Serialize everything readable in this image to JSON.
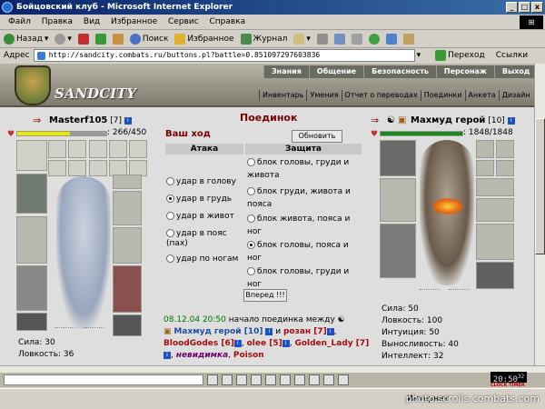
{
  "window": {
    "title": "Бойцовский клуб - Microsoft Internet Explorer",
    "min": "_",
    "max": "□",
    "close": "x"
  },
  "menu": [
    "Файл",
    "Правка",
    "Вид",
    "Избранное",
    "Сервис",
    "Справка"
  ],
  "toolbar": {
    "back": "Назад",
    "search": "Поиск",
    "favorites": "Избранное",
    "journal": "Журнал"
  },
  "address": {
    "label": "Адрес",
    "url": "http://sandcity.combats.ru/buttons.pl?battle=0.851097297603836",
    "go": "Переход",
    "links": "Ссылки"
  },
  "site": {
    "brand": "SANDCITY",
    "topnav": [
      "Знания",
      "Общение",
      "Безопасность",
      "Персонаж",
      "Выход"
    ],
    "subnav": [
      "Инвентарь",
      "Умения",
      "Отчет о переводах",
      "Поединки",
      "Анкета",
      "Дизайн"
    ]
  },
  "player": {
    "name": "Masterf105",
    "level": "[7]",
    "hp": ": 266/450",
    "hp_fraction": 0.59,
    "stats": [
      "Сила: 30",
      "Ловкость: 36"
    ]
  },
  "enemy": {
    "name": "Махмуд герой",
    "level": "[10]",
    "hp": ": 1848/1848",
    "hp_fraction": 1.0,
    "stats": [
      "Сила: 50",
      "Ловкость: 100",
      "Интуиция: 50",
      "Выносливость: 40",
      "Интеллект: 32"
    ]
  },
  "battle": {
    "title": "Поединок",
    "your_move": "Ваш ход",
    "refresh": "Обновить",
    "attack_header": "Атака",
    "defense_header": "Защита",
    "attacks": [
      "удар в голову",
      "удар в грудь",
      "удар в живот",
      "удар в пояс (пах)",
      "удар по ногам"
    ],
    "attack_selected": 1,
    "defenses": [
      "блок головы, груди и живота",
      "блок груди, живота и пояса",
      "блок живота, пояса и ног",
      "блок головы, пояса и ног",
      "блок головы, груди и ног"
    ],
    "defense_selected": 3,
    "forward": "Вперед !!!"
  },
  "log": {
    "time": "08.12.04 20:50",
    "text": "начало поединка между",
    "p1": "Махмуд герой [10]",
    "and": "и",
    "p2": "розан [7]",
    "p3": "BloodGodes [6]",
    "p4": "olee [5]",
    "p5": "Golden_Lady [7]",
    "p6": "невидимка",
    "p7": "Poison"
  },
  "clock": {
    "time": "20:50",
    "seconds": "32",
    "label": "CLOCK TIMER"
  },
  "status": {
    "text": "Интернет"
  },
  "watermark": "photo.scrolls.combats.com"
}
